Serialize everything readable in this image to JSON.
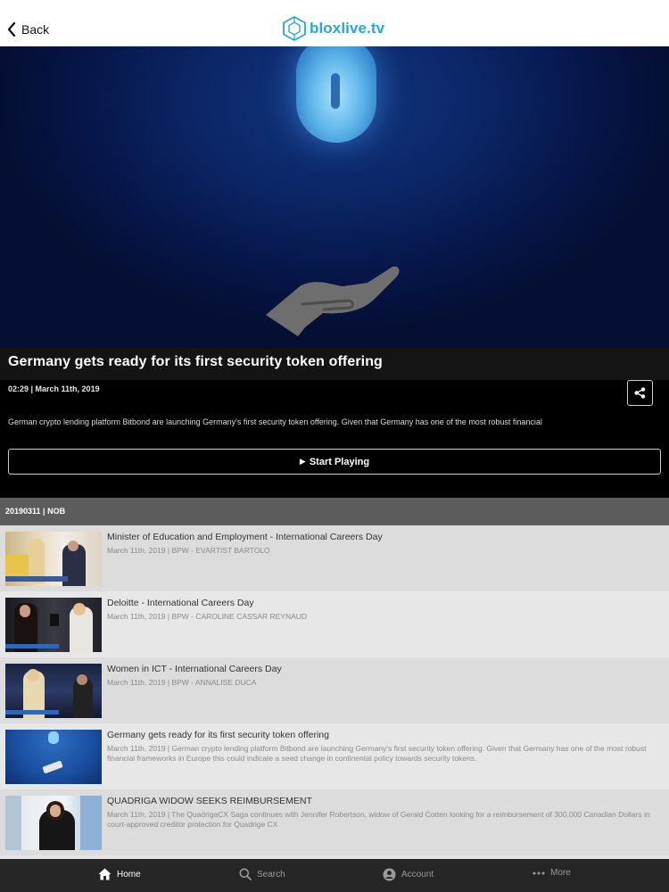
{
  "header": {
    "back_label": "Back",
    "logo_text": "bloxlive.tv"
  },
  "featured": {
    "title": "Germany gets ready for its first security token offering",
    "meta": "02:29 | March 11th, 2019",
    "description": "German crypto lending platform Bitbond are launching Germany's first security token offering. Given that Germany has one of the most robust financial",
    "play_label": "Start Playing"
  },
  "section": {
    "label": "20190311 | NOB"
  },
  "list": [
    {
      "title": "Minister of Education and Employment - International Careers Day",
      "meta": "March 11th, 2019 | BPW - EVARTIST BARTOLO"
    },
    {
      "title": "Deloitte - International Careers Day",
      "meta": "March 11th, 2019 | BPW - CAROLINE CASSAR REYNAUD"
    },
    {
      "title": "Women in ICT - International Careers Day",
      "meta": "March 11th, 2019 | BPW - ANNALISE DUCA"
    },
    {
      "title": "Germany gets ready for its first security token offering",
      "meta": "March 11th, 2019 | German crypto lending platform Bitbond are launching Germany's first security token offering. Given that Germany has one of the most robust financial frameworks in Europe this could indicate a seed change in continental policy towards security tokens."
    },
    {
      "title": "QUADRIGA WIDOW SEEKS REIMBURSEMENT",
      "meta": "March 11th, 2019 | The QuadrigaCX Saga continues with Jennifer Robertson, widow of Gerald Cotten looking for a reimbursement of 300,000 Canadian Dollars in court-approved creditor protection for Quadrige CX"
    }
  ],
  "tabs": {
    "home": "Home",
    "search": "Search",
    "account": "Account",
    "more": "More"
  },
  "colors": {
    "accent": "#2aa6d8",
    "tabbar_bg": "#262626",
    "section_bg": "#5c5c5c"
  }
}
